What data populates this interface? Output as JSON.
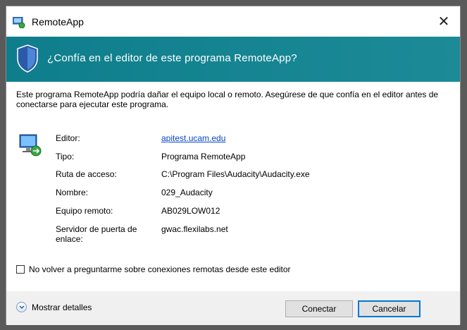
{
  "window": {
    "title": "RemoteApp",
    "close_glyph": "✕"
  },
  "banner": {
    "title": "¿Confía en el editor de este programa RemoteApp?"
  },
  "description": "Este programa RemoteApp podría dañar el equipo local o remoto. Asegúrese de que confía en el editor antes de conectarse para ejecutar este programa.",
  "details": [
    {
      "label": "Editor:",
      "value": "apitest.ucam.edu",
      "is_link": true
    },
    {
      "label": "Tipo:",
      "value": "Programa RemoteApp"
    },
    {
      "label": "Ruta de acceso:",
      "value": "C:\\Program Files\\Audacity\\Audacity.exe"
    },
    {
      "label": "Nombre:",
      "value": "029_Audacity"
    },
    {
      "label": "Equipo remoto:",
      "value": "AB029LOW012"
    },
    {
      "label": "Servidor de puerta de enlace:",
      "value": "gwac.flexilabs.net"
    }
  ],
  "checkbox": {
    "label": "No volver a preguntarme sobre conexiones remotas desde este editor",
    "checked": false
  },
  "footer": {
    "details_toggle": "Mostrar detalles",
    "connect_button": "Conectar",
    "cancel_button": "Cancelar"
  },
  "colors": {
    "banner": "#137f8c",
    "link": "#0645c9",
    "focus": "#0078d7"
  },
  "icons": [
    "remoteapp-icon",
    "shield-icon",
    "remote-pc-icon",
    "chevron-down-icon"
  ]
}
